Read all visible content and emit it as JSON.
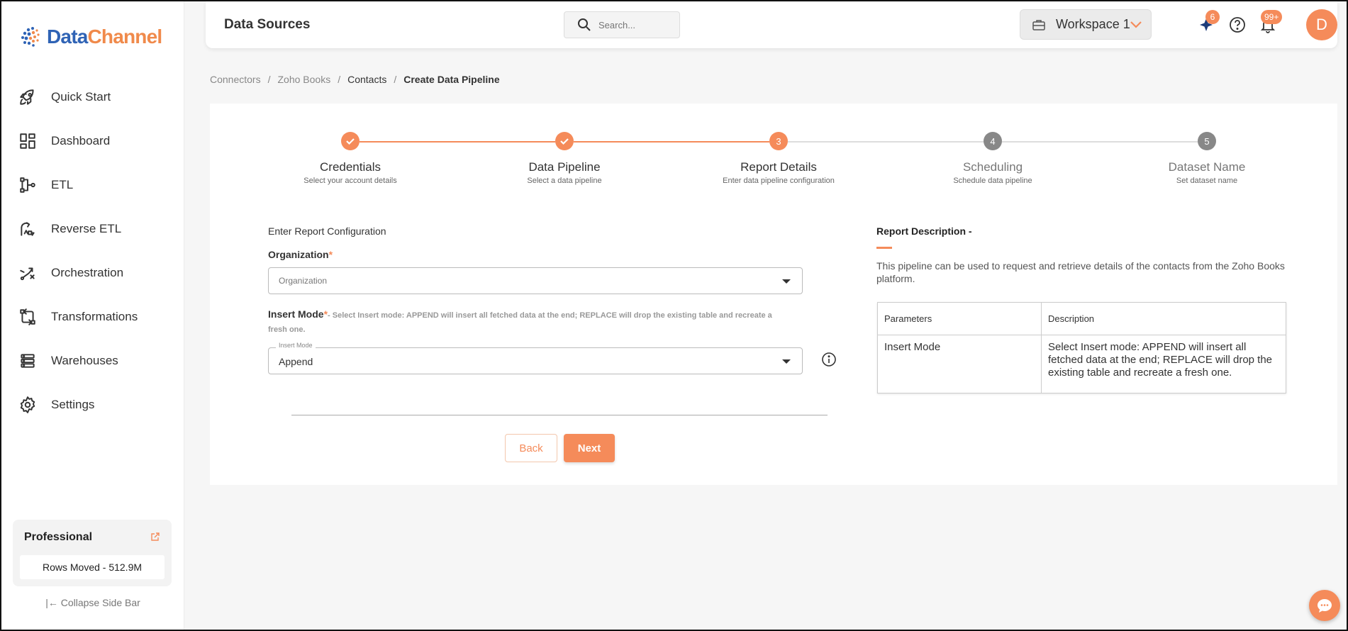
{
  "brand": {
    "part1": "Data",
    "part2": "Channel"
  },
  "sidebar": {
    "items": [
      {
        "label": "Quick Start",
        "icon": "rocket-icon"
      },
      {
        "label": "Dashboard",
        "icon": "dashboard-icon"
      },
      {
        "label": "ETL",
        "icon": "etl-icon"
      },
      {
        "label": "Reverse ETL",
        "icon": "reverse-etl-icon"
      },
      {
        "label": "Orchestration",
        "icon": "orchestration-icon"
      },
      {
        "label": "Transformations",
        "icon": "transformations-icon"
      },
      {
        "label": "Warehouses",
        "icon": "warehouses-icon"
      },
      {
        "label": "Settings",
        "icon": "gear-icon"
      }
    ],
    "plan": {
      "title": "Professional",
      "rows_moved": "Rows Moved - 512.9M"
    },
    "collapse_label": "Collapse Side Bar"
  },
  "header": {
    "title": "Data Sources",
    "search_placeholder": "Search...",
    "workspace": "Workspace 1",
    "ai_badge": "6",
    "notif_badge": "99+",
    "avatar_initial": "D"
  },
  "breadcrumb": {
    "items": [
      "Connectors",
      "Zoho Books",
      "Contacts",
      "Create Data Pipeline"
    ],
    "separator": "/"
  },
  "steps": [
    {
      "number": "1",
      "title": "Credentials",
      "subtitle": "Select your account details",
      "state": "done"
    },
    {
      "number": "2",
      "title": "Data Pipeline",
      "subtitle": "Select a data pipeline",
      "state": "done"
    },
    {
      "number": "3",
      "title": "Report Details",
      "subtitle": "Enter data pipeline configuration",
      "state": "active"
    },
    {
      "number": "4",
      "title": "Scheduling",
      "subtitle": "Schedule data pipeline",
      "state": "pending"
    },
    {
      "number": "5",
      "title": "Dataset Name",
      "subtitle": "Set dataset name",
      "state": "pending"
    }
  ],
  "form": {
    "title": "Enter Report Configuration",
    "organization": {
      "label": "Organization",
      "required": "*",
      "placeholder": "Organization"
    },
    "insert_mode": {
      "label": "Insert Mode",
      "required": "*",
      "hint": "- Select Insert mode: APPEND will insert all fetched data at the end; REPLACE will drop the existing table and recreate a fresh one.",
      "float_label": "Insert Mode",
      "value": "Append"
    },
    "back_label": "Back",
    "next_label": "Next"
  },
  "description": {
    "title": "Report Description -",
    "text": "This pipeline can be used to request and retrieve details of the contacts from the Zoho Books platform.",
    "table": {
      "headers": [
        "Parameters",
        "Description"
      ],
      "rows": [
        [
          "Insert Mode",
          "Select Insert mode: APPEND will insert all fetched data at the end; REPLACE will drop the existing table and recreate a fresh one."
        ]
      ]
    }
  },
  "colors": {
    "accent": "#f58b5a",
    "brand_blue": "#2f63b5",
    "pending": "#888888"
  }
}
